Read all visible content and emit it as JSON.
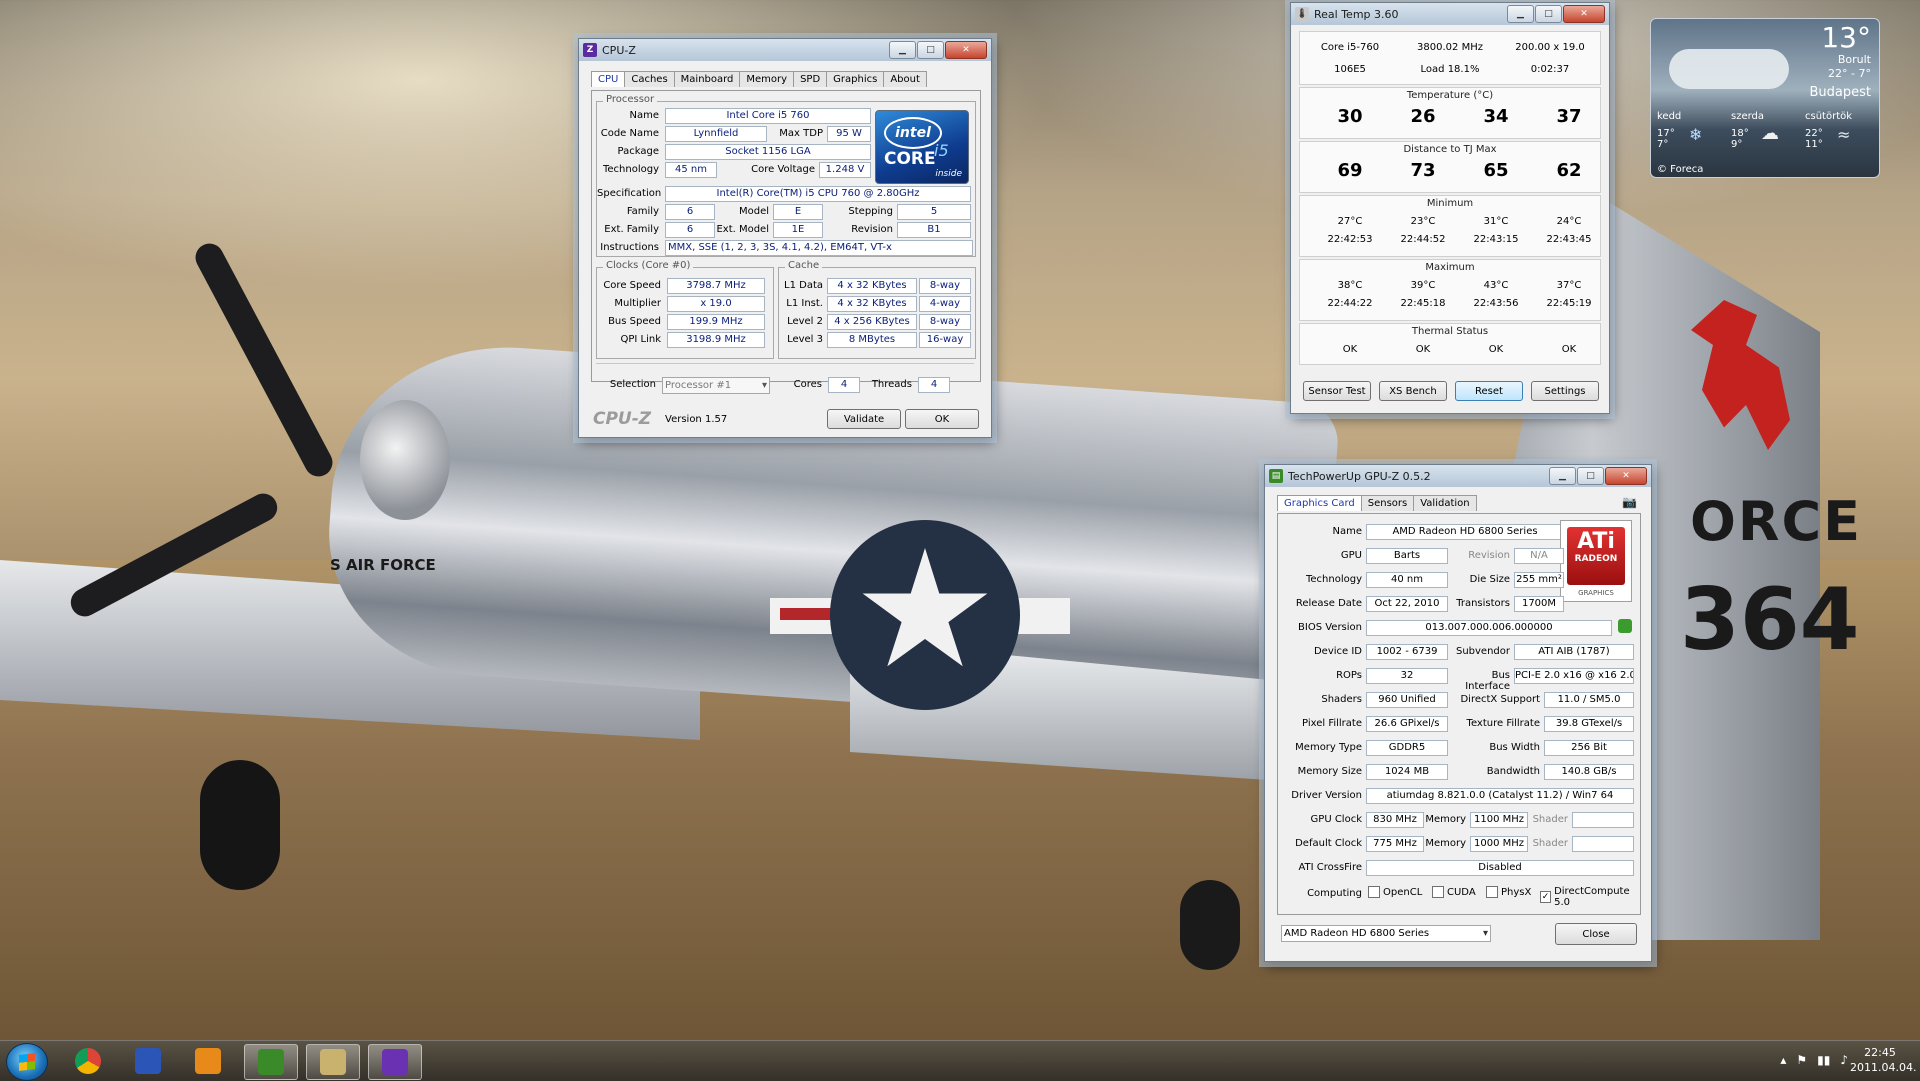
{
  "desktop": {
    "wallpaper_tail_text": "ORCE",
    "wallpaper_tail_number": "364",
    "wallpaper_fuselage_text": "S AIR FORCE"
  },
  "cpuz": {
    "title": "CPU-Z",
    "tabs": [
      "CPU",
      "Caches",
      "Mainboard",
      "Memory",
      "SPD",
      "Graphics",
      "About"
    ],
    "processor_group": "Processor",
    "name_label": "Name",
    "name": "Intel Core i5 760",
    "codename_label": "Code Name",
    "codename": "Lynnfield",
    "maxtdp_label": "Max TDP",
    "maxtdp": "95 W",
    "package_label": "Package",
    "package": "Socket 1156 LGA",
    "technology_label": "Technology",
    "technology": "45 nm",
    "corevoltage_label": "Core Voltage",
    "corevoltage": "1.248 V",
    "spec_label": "Specification",
    "spec": "Intel(R) Core(TM) i5 CPU         760  @ 2.80GHz",
    "family_label": "Family",
    "family": "6",
    "model_label": "Model",
    "model": "E",
    "stepping_label": "Stepping",
    "stepping": "5",
    "extfamily_label": "Ext. Family",
    "extfamily": "6",
    "extmodel_label": "Ext. Model",
    "extmodel": "1E",
    "revision_label": "Revision",
    "revision": "B1",
    "instructions_label": "Instructions",
    "instructions": "MMX, SSE (1, 2, 3, 3S, 4.1, 4.2), EM64T, VT-x",
    "clocks_group": "Clocks (Core #0)",
    "corespeed_label": "Core Speed",
    "corespeed": "3798.7 MHz",
    "multiplier_label": "Multiplier",
    "multiplier": "x 19.0",
    "busspeed_label": "Bus Speed",
    "busspeed": "199.9 MHz",
    "qpilink_label": "QPI Link",
    "qpilink": "3198.9 MHz",
    "cache_group": "Cache",
    "cache_rows": [
      {
        "label": "L1 Data",
        "size": "4 x 32 KBytes",
        "way": "8-way"
      },
      {
        "label": "L1 Inst.",
        "size": "4 x 32 KBytes",
        "way": "4-way"
      },
      {
        "label": "Level 2",
        "size": "4 x 256 KBytes",
        "way": "8-way"
      },
      {
        "label": "Level 3",
        "size": "8 MBytes",
        "way": "16-way"
      }
    ],
    "selection_label": "Selection",
    "selection": "Processor #1",
    "cores_label": "Cores",
    "cores": "4",
    "threads_label": "Threads",
    "threads": "4",
    "brand": "CPU-Z",
    "version": "Version 1.57",
    "validate_label": "Validate",
    "ok_label": "OK",
    "logo": {
      "brand": "intel",
      "line": "CORE",
      "model": "i5",
      "tag": "inside"
    }
  },
  "realtemp": {
    "title": "Real Temp 3.60",
    "cpu": "Core i5-760",
    "mhz": "3800.02 MHz",
    "ratio": "200.00 x 19.0",
    "cpuid": "106E5",
    "load": "Load  18.1%",
    "time": "0:02:37",
    "temp_header": "Temperature (°C)",
    "temps": [
      "30",
      "26",
      "34",
      "37"
    ],
    "dist_header": "Distance to TJ Max",
    "dists": [
      "69",
      "73",
      "65",
      "62"
    ],
    "min_header": "Minimum",
    "mins": [
      "27°C",
      "23°C",
      "31°C",
      "24°C"
    ],
    "min_times": [
      "22:42:53",
      "22:44:52",
      "22:43:15",
      "22:43:45"
    ],
    "max_header": "Maximum",
    "maxs": [
      "38°C",
      "39°C",
      "43°C",
      "37°C"
    ],
    "max_times": [
      "22:44:22",
      "22:45:18",
      "22:43:56",
      "22:45:19"
    ],
    "thermal_header": "Thermal Status",
    "thermal": [
      "OK",
      "OK",
      "OK",
      "OK"
    ],
    "buttons": [
      "Sensor Test",
      "XS Bench",
      "Reset",
      "Settings"
    ]
  },
  "weather": {
    "temp": "13°",
    "condition": "Borult",
    "range": "22° - 7°",
    "city": "Budapest",
    "forecast": [
      {
        "day": "kedd",
        "hi": "17°",
        "lo": "7°"
      },
      {
        "day": "szerda",
        "hi": "18°",
        "lo": "9°"
      },
      {
        "day": "csütörtök",
        "hi": "22°",
        "lo": "11°"
      }
    ],
    "provider": "© Foreca"
  },
  "gpuz": {
    "title": "TechPowerUp GPU-Z 0.5.2",
    "tabs": [
      "Graphics Card",
      "Sensors",
      "Validation"
    ],
    "name_label": "Name",
    "name": "AMD Radeon HD 6800 Series",
    "gpu_label": "GPU",
    "gpu": "Barts",
    "revision_label": "Revision",
    "revision": "N/A",
    "technology_label": "Technology",
    "technology": "40 nm",
    "diesize_label": "Die Size",
    "diesize": "255 mm²",
    "release_label": "Release Date",
    "release": "Oct 22, 2010",
    "transistors_label": "Transistors",
    "transistors": "1700M",
    "bios_label": "BIOS Version",
    "bios": "013.007.000.006.000000",
    "deviceid_label": "Device ID",
    "deviceid": "1002 - 6739",
    "subvendor_label": "Subvendor",
    "subvendor": "ATI AIB (1787)",
    "rops_label": "ROPs",
    "rops": "32",
    "businterface_label": "Bus Interface",
    "businterface": "PCI-E 2.0 x16 @ x16 2.0",
    "shaders_label": "Shaders",
    "shaders": "960 Unified",
    "directx_label": "DirectX Support",
    "directx": "11.0 / SM5.0",
    "pixelfill_label": "Pixel Fillrate",
    "pixelfill": "26.6 GPixel/s",
    "texfill_label": "Texture Fillrate",
    "texfill": "39.8 GTexel/s",
    "memtype_label": "Memory Type",
    "memtype": "GDDR5",
    "buswidth_label": "Bus Width",
    "buswidth": "256 Bit",
    "memsize_label": "Memory Size",
    "memsize": "1024 MB",
    "bandwidth_label": "Bandwidth",
    "bandwidth": "140.8 GB/s",
    "driver_label": "Driver Version",
    "driver": "atiumdag 8.821.0.0 (Catalyst 11.2) / Win7 64",
    "gpuclock_label": "GPU Clock",
    "gpuclock": "830 MHz",
    "gpumem_label": "Memory",
    "gpumem": "1100 MHz",
    "shader_label": "Shader",
    "shader": "",
    "defclock_label": "Default Clock",
    "defclock": "775 MHz",
    "defmem_label": "Memory",
    "defmem": "1000 MHz",
    "defshader_label": "Shader",
    "defshader": "",
    "crossfire_label": "ATI CrossFire",
    "crossfire": "Disabled",
    "computing_label": "Computing",
    "computing": [
      {
        "label": "OpenCL",
        "checked": ""
      },
      {
        "label": "CUDA",
        "checked": ""
      },
      {
        "label": "PhysX",
        "checked": ""
      },
      {
        "label": "DirectCompute 5.0",
        "checked": "✓"
      }
    ],
    "card_select": "AMD Radeon HD 6800 Series",
    "close_label": "Close",
    "logo": {
      "brand": "ATi",
      "line": "RADEON",
      "sub": "GRAPHICS"
    }
  },
  "taskbar": {
    "clock_time": "22:45",
    "clock_date": "2011.04.04.",
    "tray": [
      "▴",
      "⚑",
      "▮▮",
      "♪"
    ]
  },
  "colors": {
    "accent": "#1f3aa8",
    "value_text": "#0a1e78",
    "ati_red": "#c01818",
    "intel_blue": "#0f3c8f"
  }
}
